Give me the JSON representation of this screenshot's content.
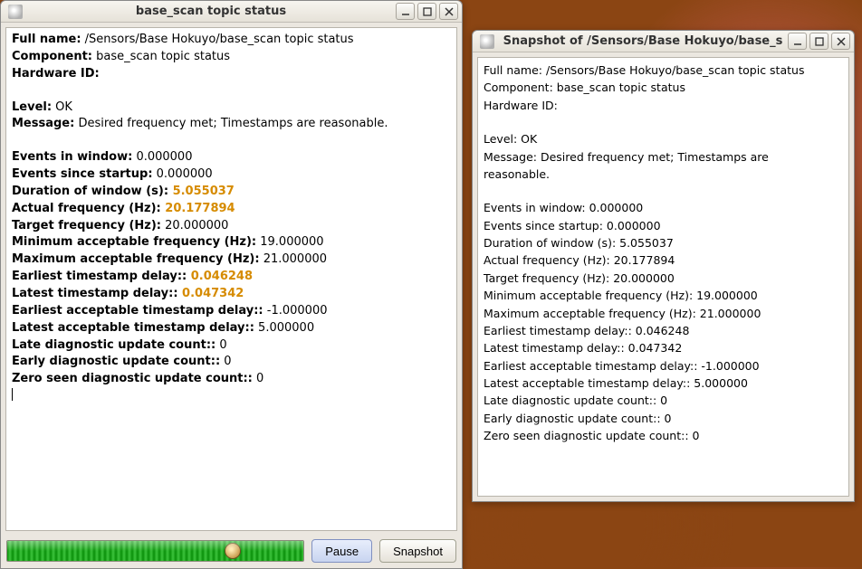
{
  "window1": {
    "title": "base_scan topic status",
    "full_name_label": "Full name:",
    "full_name_value": " /Sensors/Base Hokuyo/base_scan topic status",
    "component_label": "Component:",
    "component_value": " base_scan topic status",
    "hardware_id_label": "Hardware ID:",
    "hardware_id_value": "",
    "level_label": "Level:",
    "level_value": " OK",
    "message_label": "Message:",
    "message_value": " Desired frequency met; Timestamps are reasonable.",
    "events_window_label": "Events in window:",
    "events_window_value": " 0.000000",
    "events_startup_label": "Events since startup:",
    "events_startup_value": " 0.000000",
    "duration_label": "Duration of window (s):",
    "duration_value": " 5.055037",
    "actual_freq_label": "Actual frequency (Hz):",
    "actual_freq_value": " 20.177894",
    "target_freq_label": "Target frequency (Hz):",
    "target_freq_value": " 20.000000",
    "min_freq_label": "Minimum acceptable frequency (Hz):",
    "min_freq_value": " 19.000000",
    "max_freq_label": "Maximum acceptable frequency (Hz):",
    "max_freq_value": " 21.000000",
    "earliest_ts_label": "Earliest timestamp delay::",
    "earliest_ts_value": " 0.046248",
    "latest_ts_label": "Latest timestamp delay::",
    "latest_ts_value": " 0.047342",
    "earliest_acc_label": "Earliest acceptable timestamp delay::",
    "earliest_acc_value": " -1.000000",
    "latest_acc_label": "Latest acceptable timestamp delay::",
    "latest_acc_value": " 5.000000",
    "late_count_label": "Late diagnostic update count::",
    "late_count_value": " 0",
    "early_count_label": "Early diagnostic update count::",
    "early_count_value": " 0",
    "zero_count_label": "Zero seen diagnostic update count::",
    "zero_count_value": " 0",
    "pause_btn": "Pause",
    "snapshot_btn": "Snapshot"
  },
  "window2": {
    "title": "Snapshot of /Sensors/Base Hokuyo/base_s",
    "full_name": "Full name: /Sensors/Base Hokuyo/base_scan topic status",
    "component": "Component: base_scan topic status",
    "hardware_id": "Hardware ID:",
    "level": "Level: OK",
    "message_l1": "Message: Desired frequency met; Timestamps are",
    "message_l2": "reasonable.",
    "events_window": "Events in window: 0.000000",
    "events_startup": "Events since startup: 0.000000",
    "duration": "Duration of window (s): 5.055037",
    "actual_freq": "Actual frequency (Hz): 20.177894",
    "target_freq": "Target frequency (Hz): 20.000000",
    "min_freq": "Minimum acceptable frequency (Hz): 19.000000",
    "max_freq": "Maximum acceptable frequency (Hz): 21.000000",
    "earliest_ts": "Earliest timestamp delay:: 0.046248",
    "latest_ts": "Latest timestamp delay:: 0.047342",
    "earliest_acc": "Earliest acceptable timestamp delay:: -1.000000",
    "latest_acc": "Latest acceptable timestamp delay:: 5.000000",
    "late_count": "Late diagnostic update count:: 0",
    "early_count": "Early diagnostic update count:: 0",
    "zero_count": "Zero seen diagnostic update count:: 0"
  }
}
